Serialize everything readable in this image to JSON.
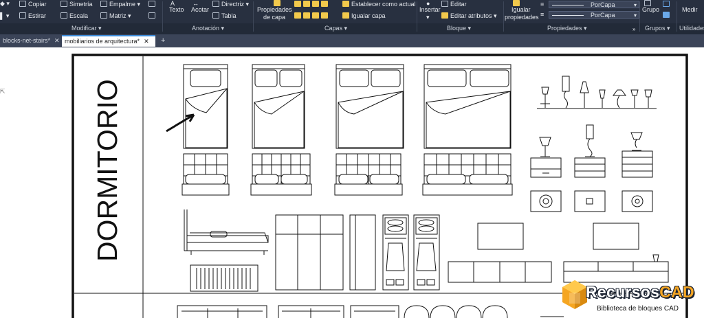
{
  "ribbon": {
    "modificar": {
      "copiar": "Copiar",
      "simetria": "Simetría",
      "empalme": "Empalme",
      "estirar": "Estirar",
      "escala": "Escala",
      "matriz": "Matriz",
      "panel": "Modificar ▾"
    },
    "anotacion": {
      "texto": "Texto",
      "acotar": "Acotar",
      "directriz": "Directriz",
      "tabla": "Tabla",
      "panel": "Anotación ▾"
    },
    "capas": {
      "propiedades_capa_1": "Propiedades",
      "propiedades_capa_2": "de capa",
      "establecer": "Establecer como actual",
      "igualar_capa": "Igualar capa",
      "panel": "Capas ▾"
    },
    "bloque": {
      "insertar": "Insertar",
      "editar": "Editar",
      "editar_atributos": "Editar atributos ▾",
      "panel": "Bloque ▾"
    },
    "propiedades": {
      "igualar_1": "Igualar",
      "igualar_2": "propiedades",
      "line1": "PorCapa",
      "line2": "PorCapa",
      "panel": "Propiedades ▾"
    },
    "grupos": {
      "grupo": "Grupo",
      "panel": "Grupos ▾"
    },
    "utilidades": {
      "medir": "Medir",
      "panel": "Utilidades"
    }
  },
  "tabs": [
    {
      "label": "blocks-net-stairs*",
      "close": "✕"
    },
    {
      "label": "mobiliarios de arquitectura*",
      "close": "✕"
    }
  ],
  "new_tab": "+",
  "drawing": {
    "room_label": "DORMITORIO"
  },
  "watermark": {
    "brand_a": "Recursos",
    "brand_b": "CAD",
    "subtitle": "Biblioteca de bloques CAD"
  },
  "colors": {
    "ribbon_bg": "#283040",
    "tabbar_bg": "#3b4458",
    "brand_orange": "#f5a623"
  }
}
